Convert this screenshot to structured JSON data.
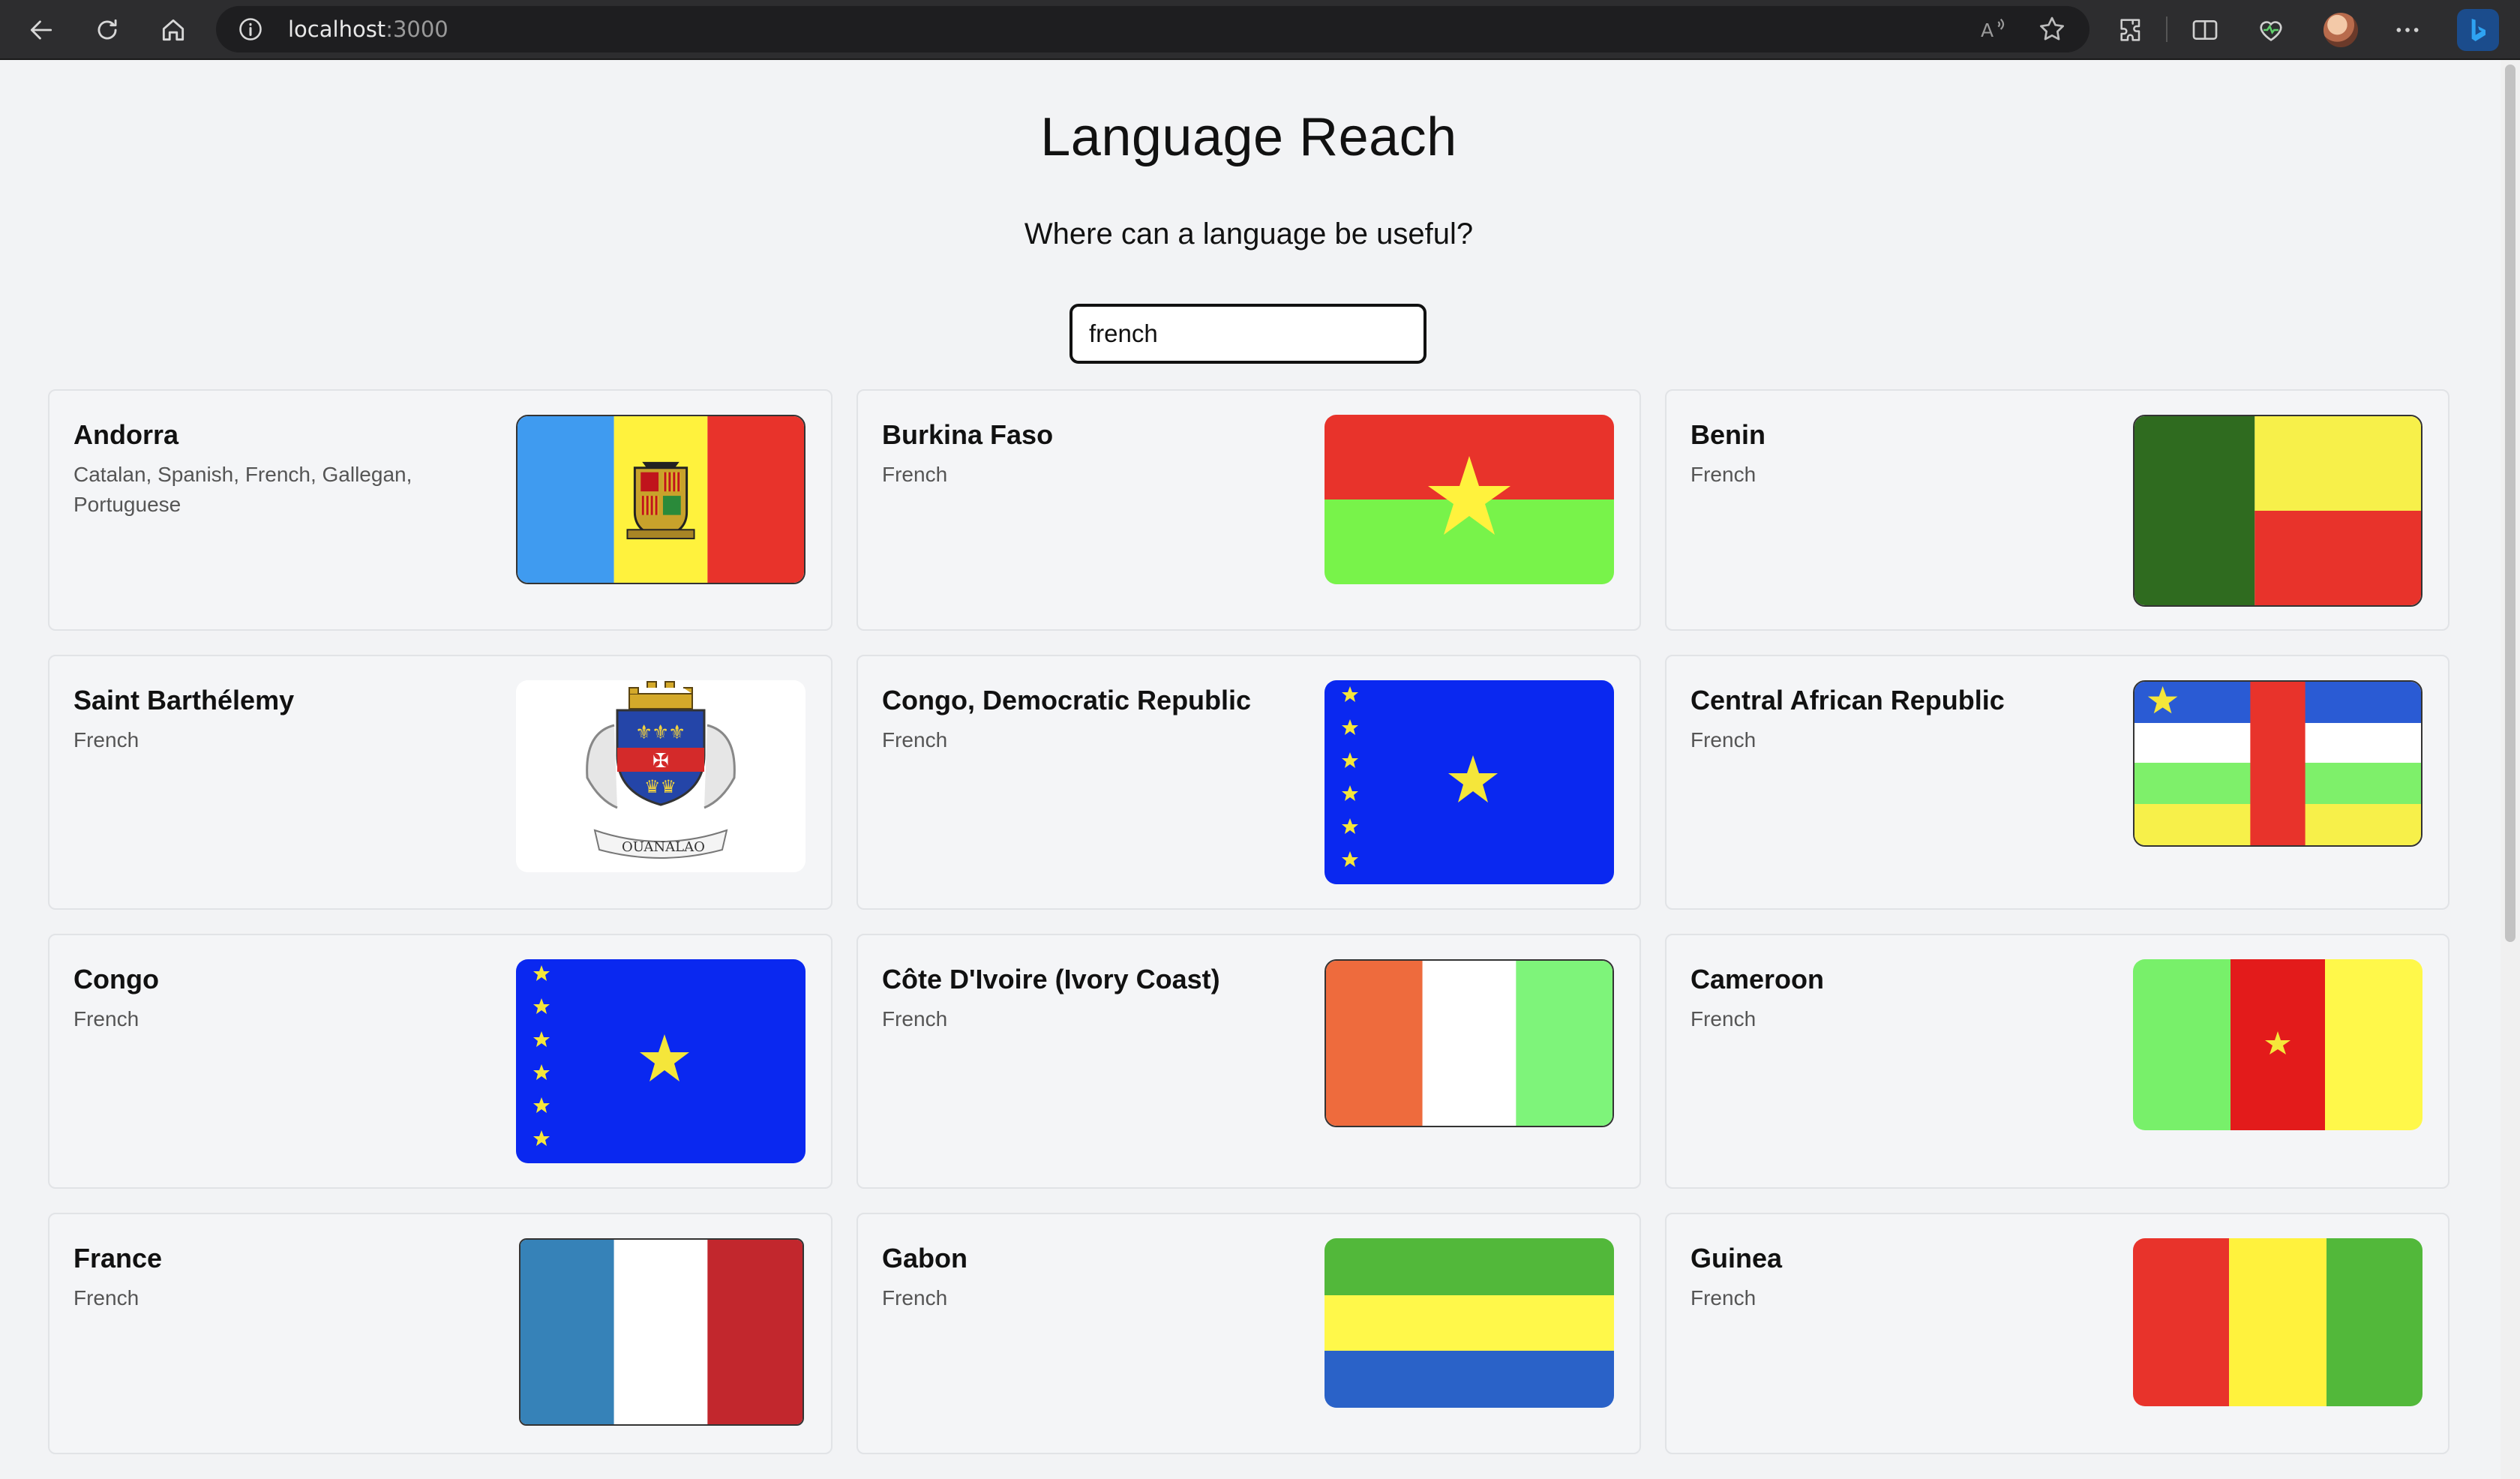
{
  "browser": {
    "url_host": "localhost",
    "url_port": ":3000"
  },
  "page": {
    "title": "Language Reach",
    "subtitle": "Where can a language be useful?",
    "search_value": "french"
  },
  "countries": [
    {
      "name": "Andorra",
      "languages": "Catalan, Spanish, French, Gallegan, Portuguese",
      "flag": "andorra-flag"
    },
    {
      "name": "Burkina Faso",
      "languages": "French",
      "flag": "burkina-faso-flag"
    },
    {
      "name": "Benin",
      "languages": "French",
      "flag": "benin-flag"
    },
    {
      "name": "Saint Barthélemy",
      "languages": "French",
      "flag": "saint-barthelemy-flag"
    },
    {
      "name": "Congo, Democratic Republic",
      "languages": "French",
      "flag": "drc-flag"
    },
    {
      "name": "Central African Republic",
      "languages": "French",
      "flag": "car-flag"
    },
    {
      "name": "Congo",
      "languages": "French",
      "flag": "congo-flag"
    },
    {
      "name": "Côte D'Ivoire (Ivory Coast)",
      "languages": "French",
      "flag": "ivory-coast-flag"
    },
    {
      "name": "Cameroon",
      "languages": "French",
      "flag": "cameroon-flag"
    },
    {
      "name": "France",
      "languages": "French",
      "flag": "france-flag"
    },
    {
      "name": "Gabon",
      "languages": "French",
      "flag": "gabon-flag"
    },
    {
      "name": "Guinea",
      "languages": "French",
      "flag": "guinea-flag"
    }
  ]
}
